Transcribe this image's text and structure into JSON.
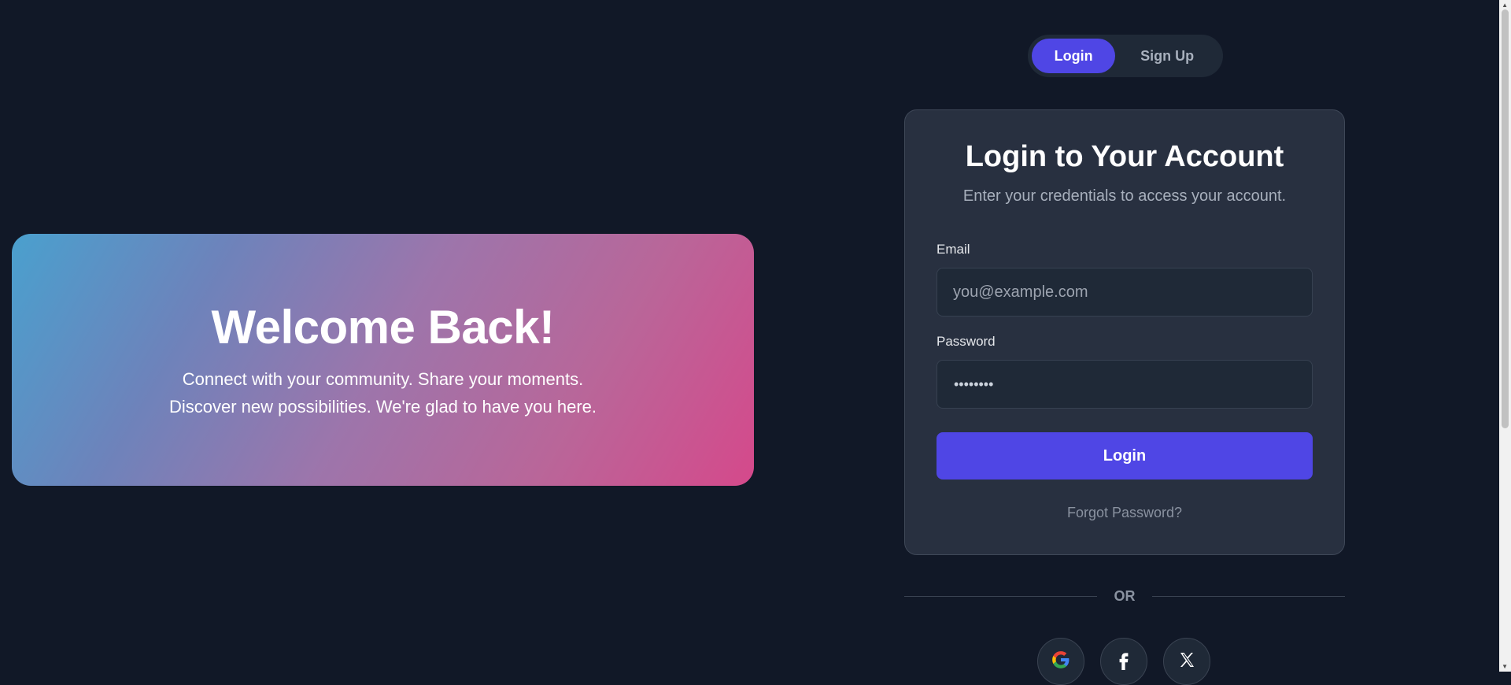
{
  "hero": {
    "title": "Welcome Back!",
    "line1": "Connect with your community. Share your moments.",
    "line2": "Discover new possibilities. We're glad to have you here."
  },
  "tabs": [
    {
      "label": "Login",
      "active": true
    },
    {
      "label": "Sign Up",
      "active": false
    }
  ],
  "card": {
    "title": "Login to Your Account",
    "subtitle": "Enter your credentials to access your account.",
    "email_label": "Email",
    "email_placeholder": "you@example.com",
    "email_value": "",
    "password_label": "Password",
    "password_value": "••••••••",
    "login_button": "Login",
    "forgot": "Forgot Password?"
  },
  "divider_text": "OR",
  "social": [
    {
      "name": "google-icon"
    },
    {
      "name": "facebook-icon"
    },
    {
      "name": "x-icon"
    }
  ],
  "colors": {
    "background": "#111827",
    "accent": "#4f46e5",
    "card": "#283040"
  }
}
